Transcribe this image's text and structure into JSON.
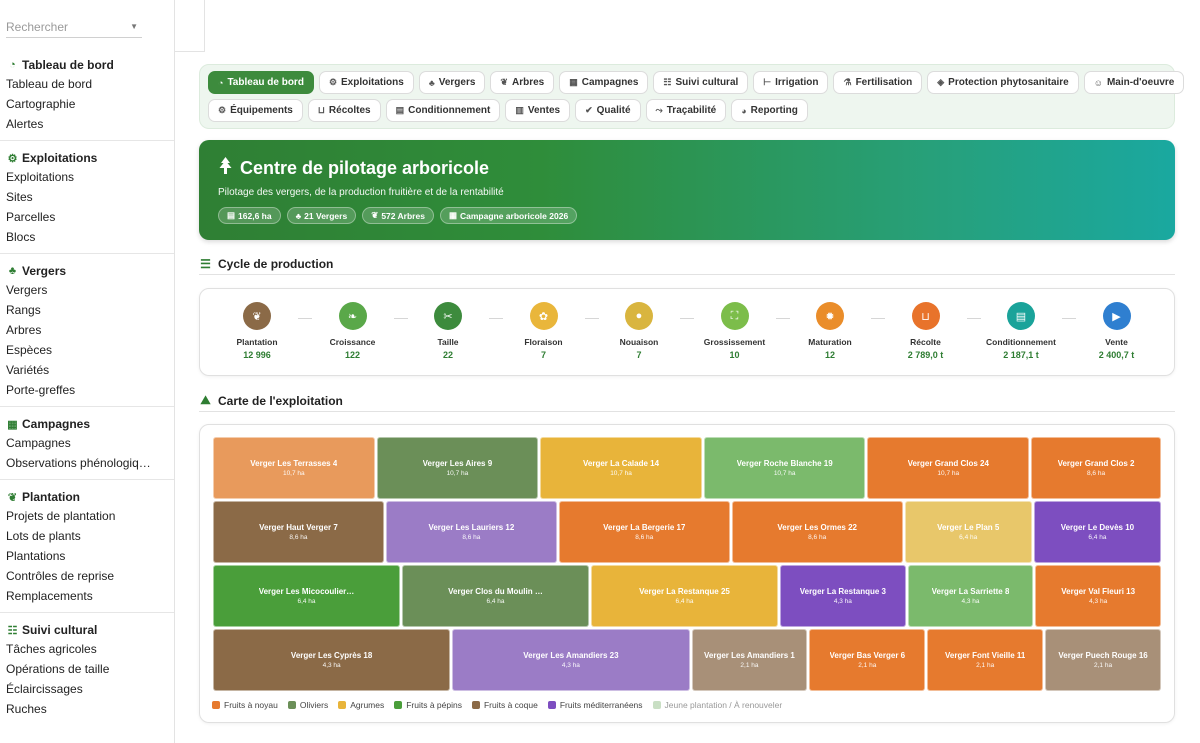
{
  "search": {
    "placeholder": "Rechercher"
  },
  "sidebar": {
    "sections": [
      {
        "title": "Tableau de bord",
        "icon": "gauge-icon",
        "items": [
          "Tableau de bord",
          "Cartographie",
          "Alertes"
        ]
      },
      {
        "title": "Exploitations",
        "icon": "tractor-icon",
        "items": [
          "Exploitations",
          "Sites",
          "Parcelles",
          "Blocs"
        ]
      },
      {
        "title": "Vergers",
        "icon": "tree-icon",
        "items": [
          "Vergers",
          "Rangs",
          "Arbres",
          "Espèces",
          "Variétés",
          "Porte-greffes"
        ]
      },
      {
        "title": "Campagnes",
        "icon": "calendar-icon",
        "items": [
          "Campagnes",
          "Observations phénologiq…"
        ]
      },
      {
        "title": "Plantation",
        "icon": "seedling-icon",
        "items": [
          "Projets de plantation",
          "Lots de plants",
          "Plantations",
          "Contrôles de reprise",
          "Remplacements"
        ]
      },
      {
        "title": "Suivi cultural",
        "icon": "list-check-icon",
        "items": [
          "Tâches agricoles",
          "Opérations de taille",
          "Éclaircissages",
          "Ruches"
        ]
      }
    ]
  },
  "nav": {
    "row1": [
      {
        "label": "Tableau de bord",
        "icon": "gauge-icon",
        "active": true
      },
      {
        "label": "Exploitations",
        "icon": "tractor-icon"
      },
      {
        "label": "Vergers",
        "icon": "tree-icon"
      },
      {
        "label": "Arbres",
        "icon": "seedling-icon"
      },
      {
        "label": "Campagnes",
        "icon": "calendar-icon"
      },
      {
        "label": "Suivi cultural",
        "icon": "list-check-icon"
      },
      {
        "label": "Irrigation",
        "icon": "faucet-icon"
      },
      {
        "label": "Fertilisation",
        "icon": "flask-icon"
      },
      {
        "label": "Protection phytosanitaire",
        "icon": "shield-icon"
      },
      {
        "label": "Main-d'oeuvre",
        "icon": "users-icon"
      }
    ],
    "row2": [
      {
        "label": "Équipements",
        "icon": "cogs-icon"
      },
      {
        "label": "Récoltes",
        "icon": "basket-icon"
      },
      {
        "label": "Conditionnement",
        "icon": "boxes-icon"
      },
      {
        "label": "Ventes",
        "icon": "receipt-icon"
      },
      {
        "label": "Qualité",
        "icon": "check-double-icon"
      },
      {
        "label": "Traçabilité",
        "icon": "route-icon"
      },
      {
        "label": "Reporting",
        "icon": "chart-pie-icon"
      }
    ]
  },
  "hero": {
    "title": "Centre de pilotage arboricole",
    "subtitle": "Pilotage des vergers, de la production fruitière et de la rentabilité",
    "badges": [
      {
        "label": "162,6 ha",
        "icon": "map-icon"
      },
      {
        "label": "21 Vergers",
        "icon": "tree-icon"
      },
      {
        "label": "572 Arbres",
        "icon": "seedling-icon"
      },
      {
        "label": "Campagne arboricole 2026",
        "icon": "calendar-icon"
      }
    ]
  },
  "cycle": {
    "title": "Cycle de production",
    "stages": [
      {
        "label": "Plantation",
        "value": "12 996",
        "color": "#8b6a47",
        "icon": "seedling-icon"
      },
      {
        "label": "Croissance",
        "value": "122",
        "color": "#5aa849",
        "icon": "sprout-icon"
      },
      {
        "label": "Taille",
        "value": "22",
        "color": "#3d8b3d",
        "icon": "scissors-icon"
      },
      {
        "label": "Floraison",
        "value": "7",
        "color": "#e9b63b",
        "icon": "flower-icon"
      },
      {
        "label": "Nouaison",
        "value": "7",
        "color": "#d9b53f",
        "icon": "circle-icon"
      },
      {
        "label": "Grossissement",
        "value": "10",
        "color": "#7cbd4a",
        "icon": "expand-icon"
      },
      {
        "label": "Maturation",
        "value": "12",
        "color": "#ea8d2a",
        "icon": "sun-icon"
      },
      {
        "label": "Récolte",
        "value": "2 789,0 t",
        "color": "#e8732b",
        "icon": "basket-icon"
      },
      {
        "label": "Conditionnement",
        "value": "2 187,1 t",
        "color": "#1aa39a",
        "icon": "boxes-icon"
      },
      {
        "label": "Vente",
        "value": "2 400,7 t",
        "color": "#2f7fd0",
        "icon": "truck-icon"
      }
    ]
  },
  "map": {
    "title": "Carte de l'exploitation",
    "rows": [
      [
        {
          "name": "Verger Les Terrasses 4",
          "area": "10,7 ha",
          "cat": "noyau_light"
        },
        {
          "name": "Verger Les Aires 9",
          "area": "10,7 ha",
          "cat": "oliviers"
        },
        {
          "name": "Verger La Calade 14",
          "area": "10,7 ha",
          "cat": "agrumes"
        },
        {
          "name": "Verger Roche Blanche 19",
          "area": "10,7 ha",
          "cat": "jeune"
        },
        {
          "name": "Verger Grand Clos 24",
          "area": "10,7 ha",
          "cat": "noyau"
        },
        {
          "name": "Verger Grand Clos 2",
          "area": "8,6 ha",
          "cat": "noyau"
        }
      ],
      [
        {
          "name": "Verger Haut Verger 7",
          "area": "8,6 ha",
          "cat": "coque"
        },
        {
          "name": "Verger Les Lauriers 12",
          "area": "8,6 ha",
          "cat": "med_light"
        },
        {
          "name": "Verger La Bergerie 17",
          "area": "8,6 ha",
          "cat": "noyau"
        },
        {
          "name": "Verger Les Ormes 22",
          "area": "8,6 ha",
          "cat": "noyau"
        },
        {
          "name": "Verger Le Plan 5",
          "area": "6,4 ha",
          "cat": "agrumes_light"
        },
        {
          "name": "Verger Le Devès 10",
          "area": "6,4 ha",
          "cat": "med"
        }
      ],
      [
        {
          "name": "Verger Les Micocoulier…",
          "area": "6,4 ha",
          "cat": "pepins"
        },
        {
          "name": "Verger Clos du Moulin …",
          "area": "6,4 ha",
          "cat": "oliviers"
        },
        {
          "name": "Verger La Restanque 25",
          "area": "6,4 ha",
          "cat": "agrumes"
        },
        {
          "name": "Verger La Restanque 3",
          "area": "4,3 ha",
          "cat": "med"
        },
        {
          "name": "Verger La Sarriette 8",
          "area": "4,3 ha",
          "cat": "jeune"
        },
        {
          "name": "Verger Val Fleuri 13",
          "area": "4,3 ha",
          "cat": "noyau"
        }
      ],
      [
        {
          "name": "Verger Les Cyprès 18",
          "area": "4,3 ha",
          "cat": "coque"
        },
        {
          "name": "Verger Les Amandiers 23",
          "area": "4,3 ha",
          "cat": "med_light"
        },
        {
          "name": "Verger Les Amandiers 1",
          "area": "2,1 ha",
          "cat": "coque_light"
        },
        {
          "name": "Verger Bas Verger 6",
          "area": "2,1 ha",
          "cat": "noyau"
        },
        {
          "name": "Verger Font Vieille 11",
          "area": "2,1 ha",
          "cat": "noyau"
        },
        {
          "name": "Verger Puech Rouge 16",
          "area": "2,1 ha",
          "cat": "coque_light"
        }
      ]
    ],
    "colors": {
      "noyau": "#e67a2e",
      "noyau_light": "#e89a5c",
      "oliviers": "#6b8f58",
      "agrumes": "#e8b43a",
      "agrumes_light": "#e8c76a",
      "pepins": "#4a9e3a",
      "coque": "#8b6a47",
      "coque_light": "#a89078",
      "med": "#7d4ec0",
      "med_light": "#9b7cc6",
      "jeune": "#7bba6c"
    },
    "legend": [
      {
        "label": "Fruits à noyau",
        "color": "#e67a2e"
      },
      {
        "label": "Oliviers",
        "color": "#6b8f58"
      },
      {
        "label": "Agrumes",
        "color": "#e8b43a"
      },
      {
        "label": "Fruits à pépins",
        "color": "#4a9e3a"
      },
      {
        "label": "Fruits à coque",
        "color": "#8b6a47"
      },
      {
        "label": "Fruits méditerranéens",
        "color": "#7d4ec0"
      },
      {
        "label": "Jeune plantation / À renouveler",
        "color": "#c9dfc4"
      }
    ]
  }
}
